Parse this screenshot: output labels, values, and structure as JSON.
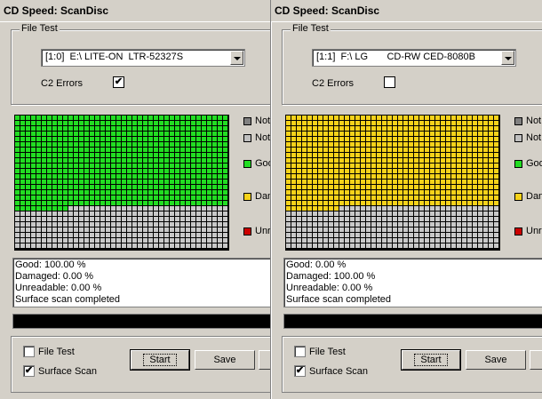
{
  "windows": [
    {
      "title": "CD Speed: ScanDisc",
      "group_label": "File Test",
      "drive": "[1:0]  E:\\ LITE-ON  LTR-52327S",
      "c2_label": "C2 Errors",
      "c2_checked": true,
      "legend": [
        "Not",
        "Not",
        "Goo",
        "Dam",
        "Unre"
      ],
      "results": [
        "Good: 100.00 %",
        "Damaged: 0.00 %",
        "Unreadable: 0.00 %",
        "Surface scan completed"
      ],
      "file_test_label": "File Test",
      "file_test_checked": false,
      "surface_scan_label": "Surface Scan",
      "surface_scan_checked": true,
      "start_label": "Start",
      "save_label": "Save",
      "fill_color": "#22dd22",
      "filled_fraction": 0.69
    },
    {
      "title": "CD Speed: ScanDisc",
      "group_label": "File Test",
      "drive": "[1:1]  F:\\ LG       CD-RW CED-8080B",
      "c2_label": "C2 Errors",
      "c2_checked": false,
      "legend": [
        "Not",
        "Not",
        "Goo",
        "Dam",
        "Unre"
      ],
      "results": [
        "Good: 0.00 %",
        "Damaged: 100.00 %",
        "Unreadable: 0.00 %",
        "Surface scan completed"
      ],
      "file_test_label": "File Test",
      "file_test_checked": false,
      "surface_scan_label": "Surface Scan",
      "surface_scan_checked": true,
      "start_label": "Start",
      "save_label": "Save",
      "fill_color": "#f6d21a",
      "filled_fraction": 0.69
    }
  ],
  "colors": {
    "not_tested": "#808080",
    "not_read": "#c0c0c0",
    "good": "#22dd22",
    "damaged": "#f6d21a",
    "unreadable": "#cc0000",
    "empty_block": "#c8c8c8"
  }
}
